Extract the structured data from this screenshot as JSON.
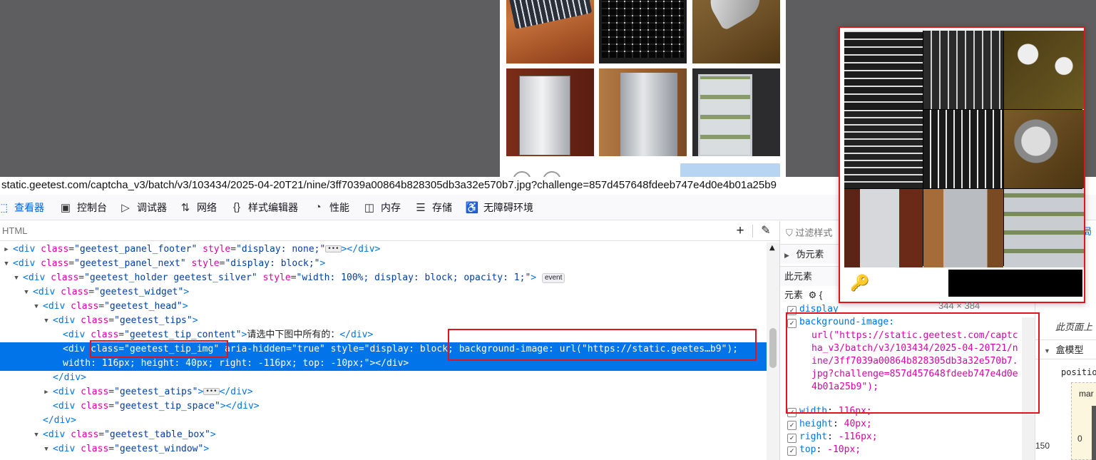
{
  "url": "static.geetest.com/captcha_v3/batch/v3/103434/2025-04-20T21/nine/3ff7039a00864b828305db3a32e570b7.jpg?challenge=857d457648fdeeb747e4d0e4b01a25b9",
  "captcha": {
    "confirm_label": "",
    "tiles": [
      "keyboard",
      "keyboard",
      "key",
      "refrigerator",
      "refrigerator",
      "refrigerator"
    ]
  },
  "devtools": {
    "tabs": [
      {
        "icon": "inspector-icon",
        "label": "查看器",
        "selected": true
      },
      {
        "icon": "console-icon",
        "label": "控制台"
      },
      {
        "icon": "debugger-icon",
        "label": "调试器"
      },
      {
        "icon": "network-icon",
        "label": "网络"
      },
      {
        "icon": "style-editor-icon",
        "label": "样式编辑器"
      },
      {
        "icon": "performance-icon",
        "label": "性能"
      },
      {
        "icon": "memory-icon",
        "label": "内存"
      },
      {
        "icon": "storage-icon",
        "label": "存储"
      },
      {
        "icon": "accessibility-icon",
        "label": "无障碍环境"
      }
    ],
    "html_panel": {
      "search_placeholder": "HTML",
      "add_node_symbol": "+",
      "picker_symbol": "✎"
    },
    "tree": {
      "r1": {
        "tag": "<div",
        "attr": "class",
        "val": "\"geetest_panel_footer\"",
        "attr2": "style",
        "val2": "\"display: none;\"",
        "close": "></div>"
      },
      "r2": {
        "tag": "<div",
        "attr": "class",
        "val": "\"geetest_panel_next\"",
        "attr2": "style",
        "val2": "\"display: block;\"",
        "close": ">"
      },
      "r3": {
        "tag": "<div",
        "attr": "class",
        "val": "\"geetest_holder geetest_silver\"",
        "attr2": "style",
        "val2": "\"width: 100%; display: block; opacity: 1;\"",
        "close": ">",
        "badge": "event"
      },
      "r4": {
        "tag": "<div",
        "attr": "class",
        "val": "\"geetest_widget\"",
        "close": ">"
      },
      "r5": {
        "tag": "<div",
        "attr": "class",
        "val": "\"geetest_head\"",
        "close": ">"
      },
      "r6": {
        "tag": "<div",
        "attr": "class",
        "val": "\"geetest_tips\"",
        "close": ">"
      },
      "r7": {
        "tag": "<div",
        "attr": "class",
        "val": "\"geetest_tip_content\"",
        "close": ">",
        "text": "请选中下图中所有的：",
        "end": "</div>"
      },
      "r8": {
        "line1": "<div class=\"geetest_tip_img\" aria-hidden=\"true\" style=\"display: block; background-image: url(\"https://static.geetes…b9\");",
        "line2": "width: 116px; height: 40px; right: -116px; top: -10px;\"></div>"
      },
      "r9": {
        "text": "</div>"
      },
      "r10": {
        "tag": "<div",
        "attr": "class",
        "val": "\"geetest_atips\"",
        "close": ">",
        "end": "</div>"
      },
      "r11": {
        "tag": "<div",
        "attr": "class",
        "val": "\"geetest_tip_space\"",
        "close": ">",
        "end": "</div>"
      },
      "r12": {
        "text": "</div>"
      },
      "r13": {
        "tag": "<div",
        "attr": "class",
        "val": "\"geetest_table_box\"",
        "close": ">"
      },
      "r14": {
        "tag": "<div",
        "attr": "class",
        "val": "\"geetest_window\"",
        "close": ">"
      }
    },
    "rules": {
      "filter_placeholder": "过滤样式",
      "pseudo_label": "伪元素",
      "this_element_label": "此元素",
      "element_label": "元素",
      "brace": "{",
      "decls": {
        "display": {
          "name": "display",
          "value": ""
        },
        "bg": {
          "name": "background-image:",
          "value": ""
        },
        "bg_url": "url(\"https://static.geetest.com/captcha_v3/batch/v3/103434/2025-04-20T21/nine/3ff7039a00864b828305db3a32e570b7.jpg?challenge=857d457648fdeeb747e4d0e4b01a25b9\");",
        "width": {
          "name": "width",
          "value": "116px;"
        },
        "height": {
          "name": "height",
          "value": "40px;"
        },
        "right": {
          "name": "right",
          "value": "-116px;"
        },
        "top": {
          "name": "top",
          "value": "-10px;"
        }
      }
    },
    "layout_panel": {
      "tab_fragment": "局",
      "partial_text": "此页面上",
      "box_model_label": "盒模型",
      "position_label": "positio",
      "margin_label": "mar",
      "value_150": "150",
      "value_0": "0"
    },
    "preview": {
      "size_label": "344 × 384"
    }
  }
}
